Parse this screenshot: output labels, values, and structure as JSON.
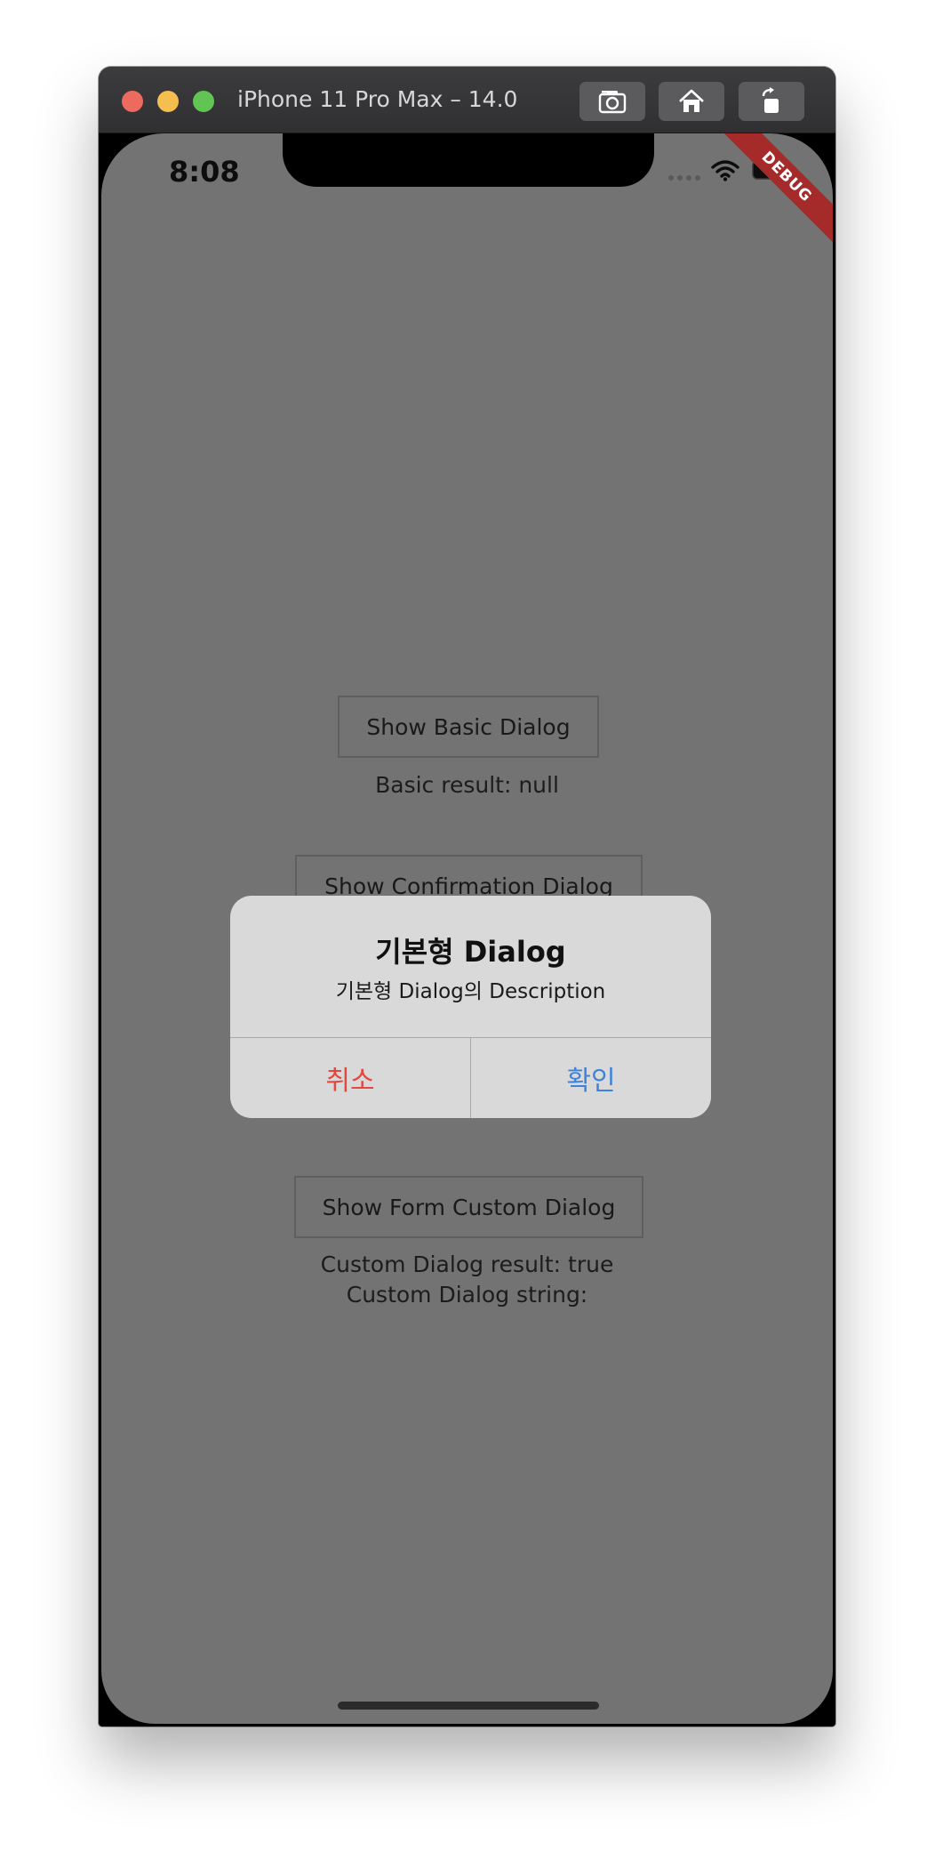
{
  "window": {
    "title": "iPhone 11 Pro Max – 14.0"
  },
  "toolbar": {
    "icons": [
      "camera-icon",
      "home-icon",
      "rotate-icon"
    ]
  },
  "status_bar": {
    "time": "8:08",
    "icons": [
      "signal-icon",
      "wifi-icon",
      "battery-icon"
    ]
  },
  "debug_banner": {
    "label": "DEBUG"
  },
  "main": {
    "basic_button_label": "Show Basic Dialog",
    "basic_result": "Basic result: null",
    "confirmation_button_label": "Show Confirmation Dialog",
    "form_button_label": "Show Form Custom Dialog",
    "custom_result": "Custom Dialog result: true",
    "custom_string": "Custom Dialog string:"
  },
  "dialog": {
    "title": "기본형 Dialog",
    "description": "기본형 Dialog의 Description",
    "cancel_label": "취소",
    "confirm_label": "확인"
  },
  "colors": {
    "overlay": "#737373",
    "dialog_background": "#d9d9d9",
    "cancel": "#e4473d",
    "confirm": "#3d83dc",
    "debug_banner": "#a52b2b"
  }
}
